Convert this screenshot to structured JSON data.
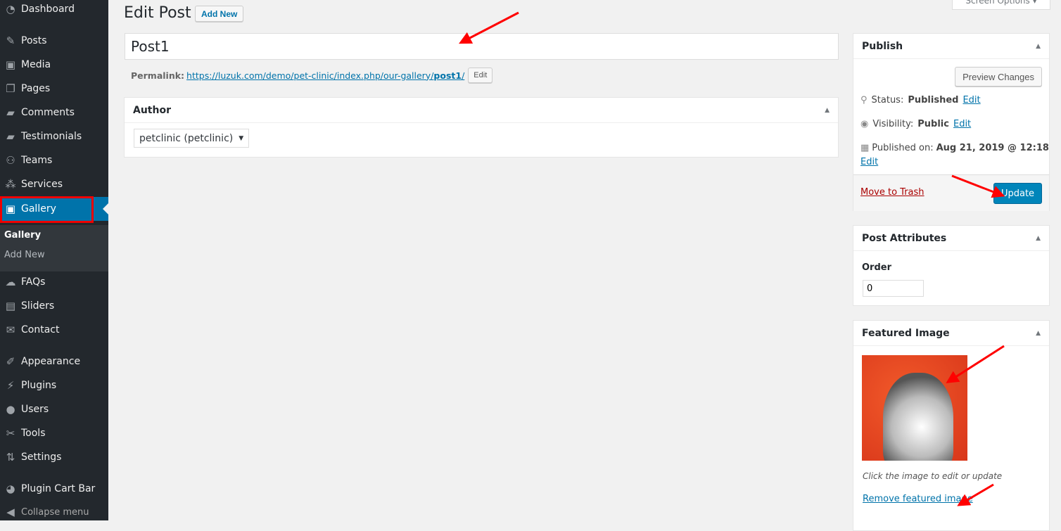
{
  "sidebar": {
    "items": [
      {
        "label": "Dashboard",
        "icon": "dashboard-icon",
        "glyph": "◔"
      },
      {
        "label": "Posts",
        "icon": "pin-icon",
        "glyph": "✎"
      },
      {
        "label": "Media",
        "icon": "media-icon",
        "glyph": "▣"
      },
      {
        "label": "Pages",
        "icon": "pages-icon",
        "glyph": "❐"
      },
      {
        "label": "Comments",
        "icon": "comment-icon",
        "glyph": "▰"
      },
      {
        "label": "Testimonials",
        "icon": "testimonials-icon",
        "glyph": "▰"
      },
      {
        "label": "Teams",
        "icon": "teams-icon",
        "glyph": "⚇"
      },
      {
        "label": "Services",
        "icon": "services-icon",
        "glyph": "⁂"
      },
      {
        "label": "Gallery",
        "icon": "gallery-icon",
        "glyph": "▣"
      },
      {
        "label": "FAQs",
        "icon": "faq-icon",
        "glyph": "☁"
      },
      {
        "label": "Sliders",
        "icon": "sliders-icon",
        "glyph": "▤"
      },
      {
        "label": "Contact",
        "icon": "mail-icon",
        "glyph": "✉"
      },
      {
        "label": "Appearance",
        "icon": "brush-icon",
        "glyph": "✐"
      },
      {
        "label": "Plugins",
        "icon": "plugin-icon",
        "glyph": "⚡"
      },
      {
        "label": "Users",
        "icon": "user-icon",
        "glyph": "●"
      },
      {
        "label": "Tools",
        "icon": "wrench-icon",
        "glyph": "✂"
      },
      {
        "label": "Settings",
        "icon": "settings-icon",
        "glyph": "⇅"
      },
      {
        "label": "Plugin Cart Bar",
        "icon": "cart-bar-icon",
        "glyph": "◕"
      }
    ],
    "submenu": [
      "Gallery",
      "Add New"
    ],
    "collapse": "Collapse menu"
  },
  "header": {
    "title": "Edit Post",
    "add_new": "Add New",
    "screen_options": "Screen Options ▾"
  },
  "post": {
    "title": "Post1",
    "permalink_label": "Permalink:",
    "permalink_base": "https://luzuk.com/demo/pet-clinic/index.php/our-gallery/",
    "permalink_slug": "post1",
    "permalink_end": "/",
    "edit": "Edit"
  },
  "author": {
    "title": "Author",
    "selected": "petclinic (petclinic)"
  },
  "publish": {
    "title": "Publish",
    "preview": "Preview Changes",
    "status_label": "Status:",
    "status": "Published",
    "visibility_label": "Visibility:",
    "visibility": "Public",
    "published_label": "Published on:",
    "published": "Aug 21, 2019 @ 12:18",
    "edit": "Edit",
    "trash": "Move to Trash",
    "update": "Update"
  },
  "attributes": {
    "title": "Post Attributes",
    "order_label": "Order",
    "order": "0"
  },
  "featured": {
    "title": "Featured Image",
    "hint": "Click the image to edit or update",
    "remove": "Remove featured image"
  },
  "colors": {
    "sidebar": "#23282d",
    "accent": "#0073aa",
    "annotation": "#ff0000"
  }
}
